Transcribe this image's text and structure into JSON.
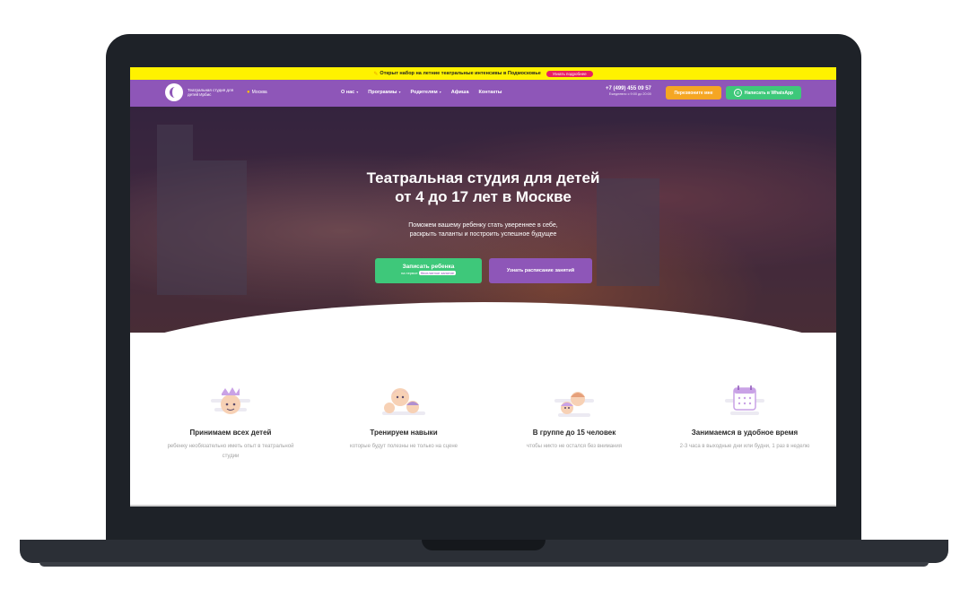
{
  "announcement": {
    "text": "Открыт набор на летние театральные интенсивы в Подмосковье",
    "button": "Узнать подробнее"
  },
  "nav": {
    "logo_text": "Театральная студия для детей Ирбис",
    "city": "Москва",
    "menu": [
      {
        "label": "О нас",
        "has_dropdown": true
      },
      {
        "label": "Программы",
        "has_dropdown": true
      },
      {
        "label": "Родителям",
        "has_dropdown": true
      },
      {
        "label": "Афиша",
        "has_dropdown": false
      },
      {
        "label": "Контакты",
        "has_dropdown": false
      }
    ],
    "phone": "+7 (499) 455 09 57",
    "hours": "Ежедневно с 9:00 до 20:00",
    "callback_button": "Перезвоните мне",
    "whatsapp_button": "Написать в WhatsApp"
  },
  "hero": {
    "title_line1": "Театральная студия для детей",
    "title_line2": "от 4 до 17 лет в Москве",
    "subtitle_line1": "Поможем вашему ребенку стать увереннее в себе,",
    "subtitle_line2": "раскрыть таланты и построить успешное будущее",
    "cta_primary": "Записать ребенка",
    "cta_primary_small_prefix": "на первое",
    "cta_primary_small_pill": "бесплатное занятие",
    "cta_secondary": "Узнать расписание занятий"
  },
  "features": [
    {
      "icon": "child-crown-icon",
      "title": "Принимаем всех детей",
      "desc": "ребенку необязательно иметь опыт в театральной студии"
    },
    {
      "icon": "family-icon",
      "title": "Тренируем навыки",
      "desc": "которые будут полезны не только на сцене"
    },
    {
      "icon": "group-icon",
      "title": "В группе до 15 человек",
      "desc": "чтобы никто не остался без внимания"
    },
    {
      "icon": "calendar-icon",
      "title": "Занимаемся в удобное время",
      "desc": "2-3 часа в выходные дни или будни, 1 раз в неделю"
    }
  ],
  "colors": {
    "accent_purple": "#8e56b8",
    "announce_yellow": "#fff200",
    "green": "#3ec87a",
    "orange": "#f5a623",
    "pink": "#e91e63"
  }
}
